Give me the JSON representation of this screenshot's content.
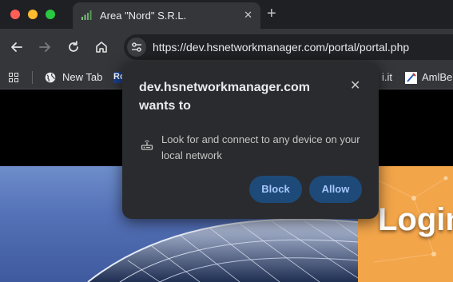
{
  "tab": {
    "title": "Area \"Nord\" S.R.L.",
    "close": "✕"
  },
  "new_tab_glyph": "+",
  "toolbar": {
    "url": "https://dev.hsnetworkmanager.com/portal/portal.php",
    "icons": [
      "back-icon",
      "forward-icon",
      "reload-icon",
      "home-icon",
      "site-info-icon"
    ]
  },
  "bookmarks": {
    "items": [
      {
        "label": "New Tab"
      },
      {
        "label": "Ro"
      },
      {
        "label": "i.it"
      },
      {
        "label": "AmlBe"
      }
    ]
  },
  "page": {
    "login_heading": "Login"
  },
  "popup": {
    "origin": "dev.hsnetworkmanager.com",
    "wants_to": "wants to",
    "permission_text": "Look for and connect to any device on your local network",
    "close": "✕",
    "block_label": "Block",
    "allow_label": "Allow"
  },
  "colors": {
    "popup_bg": "#2a2b2e",
    "button_bg": "#1e4a7a",
    "button_text": "#a8c7fa",
    "panel": "#f3a54a"
  }
}
